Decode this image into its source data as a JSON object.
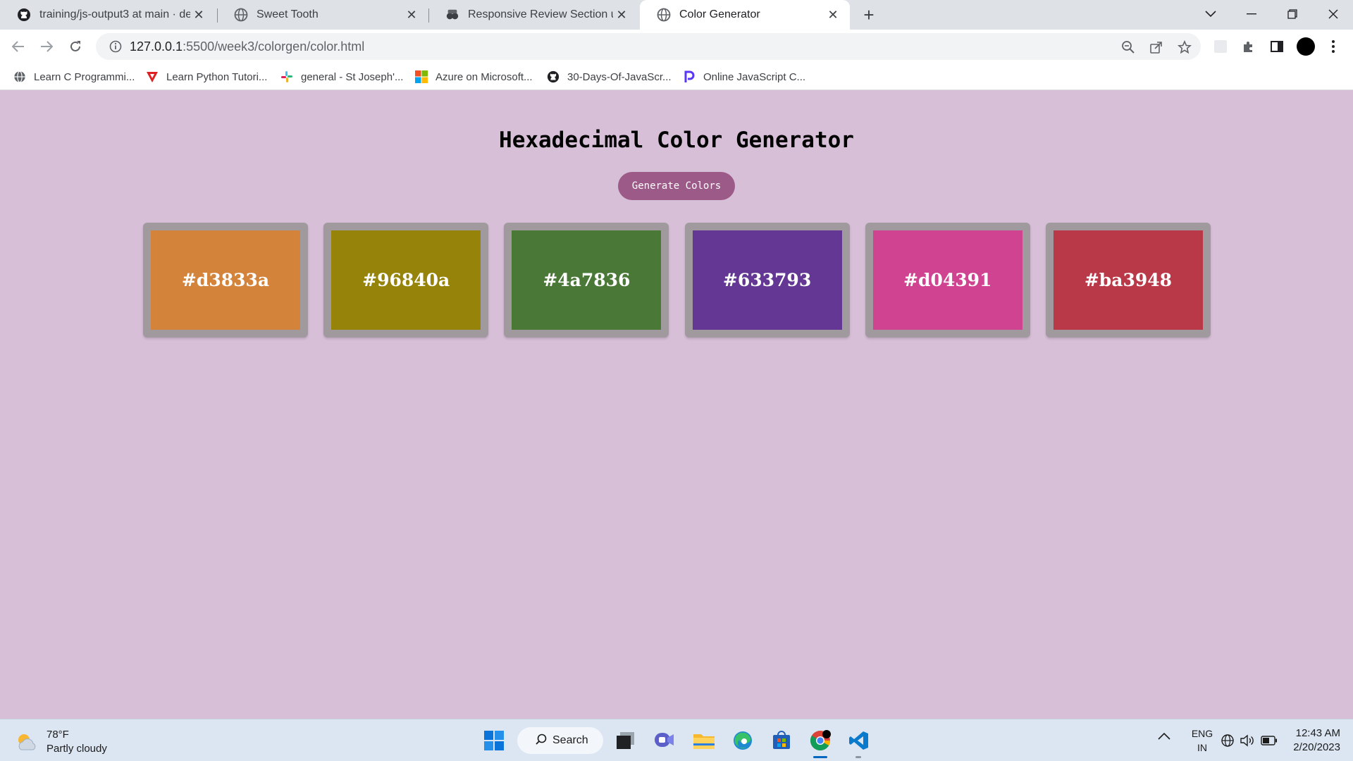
{
  "browser": {
    "tabs": [
      {
        "title": "training/js-output3 at main · dee",
        "icon": "github-icon",
        "active": false
      },
      {
        "title": "Sweet Tooth",
        "icon": "globe-icon",
        "active": false
      },
      {
        "title": "Responsive Review Section using",
        "icon": "devto-icon",
        "active": false
      },
      {
        "title": "Color Generator",
        "icon": "globe-icon",
        "active": true
      }
    ],
    "url_host": "127.0.0.1",
    "url_path": ":5500/week3/colorgen/color.html",
    "bookmarks": [
      {
        "label": "Learn C Programmi...",
        "icon": "globe-icon"
      },
      {
        "label": "Learn Python Tutori...",
        "icon": "triangle-logo-icon"
      },
      {
        "label": "general - St Joseph'...",
        "icon": "slack-icon"
      },
      {
        "label": "Azure on Microsoft...",
        "icon": "microsoft-icon"
      },
      {
        "label": "30-Days-Of-JavaScr...",
        "icon": "github-icon"
      },
      {
        "label": "Online JavaScript C...",
        "icon": "p-logo-icon"
      }
    ]
  },
  "page": {
    "heading": "Hexadecimal Color Generator",
    "button_label": "Generate Colors",
    "colors": [
      {
        "hex": "#d3833a"
      },
      {
        "hex": "#96840a"
      },
      {
        "hex": "#4a7836"
      },
      {
        "hex": "#633793"
      },
      {
        "hex": "#d04391"
      },
      {
        "hex": "#ba3948"
      }
    ]
  },
  "taskbar": {
    "weather_temp": "78°F",
    "weather_desc": "Partly cloudy",
    "search_label": "Search",
    "lang_line1": "ENG",
    "lang_line2": "IN",
    "time": "12:43 AM",
    "date": "2/20/2023"
  }
}
